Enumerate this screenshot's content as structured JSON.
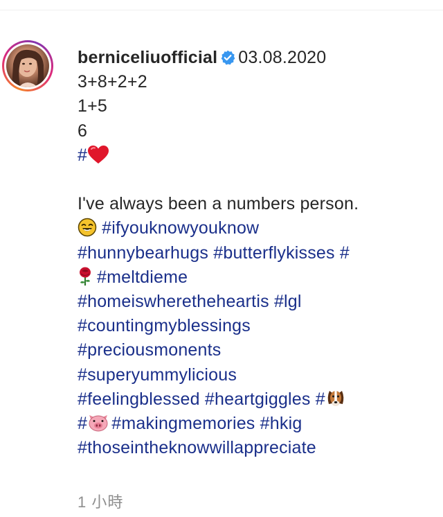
{
  "post": {
    "username": "berniceliuofficial",
    "date": "03.08.2020",
    "lines": {
      "l1": "3+8+2+2",
      "l2": "1+5",
      "l3": "6",
      "l4_hash": "#",
      "l5": "I've always been a numbers person."
    },
    "hashtags": {
      "ifyouknow": "#ifyouknowyouknow",
      "hunnybear": "#hunnybearhugs",
      "butterfly": "#butterflykisses",
      "hash_rose": "#",
      "meltdieme": "#meltdieme",
      "homeis": "#homeiswheretheheartis",
      "lgl": "#lgl",
      "counting": "#countingmyblessings",
      "precious": "#preciousmonents",
      "superyummy": "#superyummylicious",
      "feelingblessed": "#feelingblessed",
      "heartgiggles": "#heartgiggles",
      "hash_dog": "#",
      "hash_pig": "#",
      "making": "#makingmemories",
      "hkig": "#hkig",
      "thosein": "#thoseintheknowwillappreciate"
    },
    "time_ago": "1 小時"
  },
  "icons": {
    "verified": "verified-badge-icon",
    "heart": "red-heart-emoji",
    "face": "smiling-face-emoji",
    "rose": "rose-emoji",
    "dog": "dog-face-emoji",
    "pig": "pig-face-emoji"
  },
  "colors": {
    "hashtag": "#1a2f8a",
    "verified": "#3897f0",
    "secondary_text": "#8e8e8e"
  }
}
